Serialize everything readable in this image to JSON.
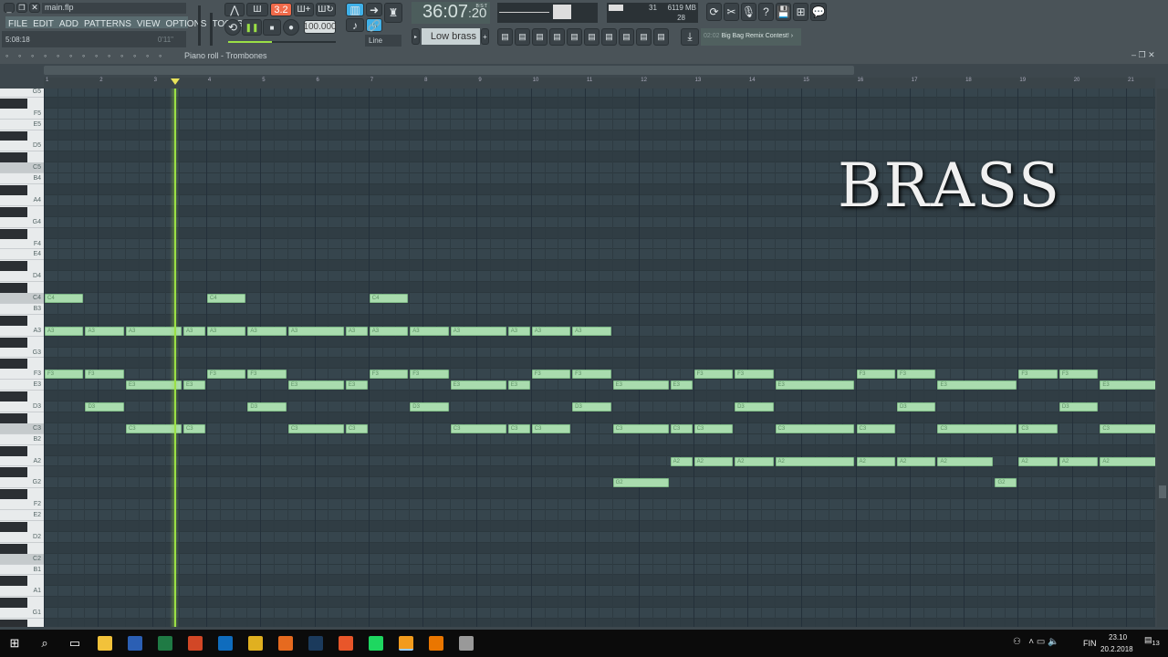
{
  "window": {
    "file": "main.flp",
    "menu": [
      "FILE",
      "EDIT",
      "ADD",
      "PATTERNS",
      "VIEW",
      "OPTIONS",
      "TOOLS",
      "?"
    ],
    "song_position": "5:08:18",
    "hint_time": "0'11\""
  },
  "transport": {
    "pattern_mode": "3.2",
    "tempo": "100.000",
    "time": "36:07",
    "time_frac": "20",
    "time_unit": "B:S:T",
    "snap": "Line"
  },
  "monitor": {
    "voices": "31",
    "memory": "6119 MB",
    "cpu": "28"
  },
  "pattern": {
    "name": "Low brass"
  },
  "news": {
    "time": "02:02",
    "text": "Big Bag Remix Contest!"
  },
  "piano_roll": {
    "title": "Piano roll - Trombones",
    "bars": 21,
    "playhead_beat": 9.65,
    "overlay_text": "BRASS",
    "top_note": "G5",
    "bottom_note": "G1",
    "notes": [
      [
        "C4",
        0,
        3
      ],
      [
        "C4",
        12,
        3
      ],
      [
        "C4",
        24,
        3
      ],
      [
        "A3",
        0,
        3
      ],
      [
        "A3",
        3,
        3
      ],
      [
        "A3",
        6,
        4.25
      ],
      [
        "A3",
        10.25,
        1.75
      ],
      [
        "A3",
        12,
        3
      ],
      [
        "A3",
        15,
        3
      ],
      [
        "A3",
        18,
        4.25
      ],
      [
        "A3",
        22.25,
        1.75
      ],
      [
        "A3",
        24,
        3
      ],
      [
        "A3",
        27,
        3
      ],
      [
        "A3",
        30,
        4.25
      ],
      [
        "A3",
        34.25,
        1.75
      ],
      [
        "A3",
        36,
        3
      ],
      [
        "A3",
        39,
        3
      ],
      [
        "F3",
        0,
        3
      ],
      [
        "F3",
        3,
        3
      ],
      [
        "F3",
        12,
        3
      ],
      [
        "F3",
        15,
        3
      ],
      [
        "F3",
        24,
        3
      ],
      [
        "F3",
        27,
        3
      ],
      [
        "F3",
        36,
        3
      ],
      [
        "F3",
        39,
        3
      ],
      [
        "F3",
        48,
        3
      ],
      [
        "F3",
        51,
        3
      ],
      [
        "F3",
        60,
        3
      ],
      [
        "F3",
        63,
        3
      ],
      [
        "F3",
        72,
        3
      ],
      [
        "F3",
        75,
        3
      ],
      [
        "E3",
        6,
        4.25
      ],
      [
        "E3",
        10.25,
        1.75
      ],
      [
        "E3",
        18,
        4.25
      ],
      [
        "E3",
        22.25,
        1.75
      ],
      [
        "E3",
        30,
        4.25
      ],
      [
        "E3",
        34.25,
        1.75
      ],
      [
        "E3",
        42,
        4.25
      ],
      [
        "E3",
        46.25,
        1.75
      ],
      [
        "E3",
        54,
        6
      ],
      [
        "E3",
        66,
        6
      ],
      [
        "E3",
        78,
        6
      ],
      [
        "D3",
        3,
        3
      ],
      [
        "D3",
        15,
        3
      ],
      [
        "D3",
        27,
        3
      ],
      [
        "D3",
        39,
        3
      ],
      [
        "D3",
        51,
        3
      ],
      [
        "D3",
        63,
        3
      ],
      [
        "D3",
        75,
        3
      ],
      [
        "C3",
        6,
        4.25
      ],
      [
        "C3",
        10.25,
        1.75
      ],
      [
        "C3",
        18,
        4.25
      ],
      [
        "C3",
        22.25,
        1.75
      ],
      [
        "C3",
        30,
        4.25
      ],
      [
        "C3",
        34.25,
        1.75
      ],
      [
        "C3",
        36,
        3
      ],
      [
        "C3",
        42,
        4.25
      ],
      [
        "C3",
        46.25,
        1.75
      ],
      [
        "C3",
        48,
        3
      ],
      [
        "C3",
        54,
        6
      ],
      [
        "C3",
        60,
        3
      ],
      [
        "C3",
        66,
        6
      ],
      [
        "C3",
        72,
        3
      ],
      [
        "C3",
        78,
        6
      ],
      [
        "A2",
        46.25,
        1.75
      ],
      [
        "A2",
        48,
        3
      ],
      [
        "A2",
        51,
        3
      ],
      [
        "A2",
        54,
        6
      ],
      [
        "A2",
        60,
        3
      ],
      [
        "A2",
        63,
        3
      ],
      [
        "A2",
        66,
        4.25
      ],
      [
        "A2",
        72,
        3
      ],
      [
        "A2",
        75,
        3
      ],
      [
        "A2",
        78,
        6
      ],
      [
        "G2",
        42,
        4.25
      ],
      [
        "G2",
        70.25,
        1.75
      ]
    ]
  },
  "tray": {
    "lang": "FIN",
    "time": "23.10",
    "date": "20.2.2018",
    "notifications": "13"
  },
  "colors": {
    "note": "#a9dcae",
    "playhead": "#9be045",
    "grid": "#35434b",
    "accent_orange": "#f06a4a",
    "accent_blue": "#3fb0e8"
  }
}
